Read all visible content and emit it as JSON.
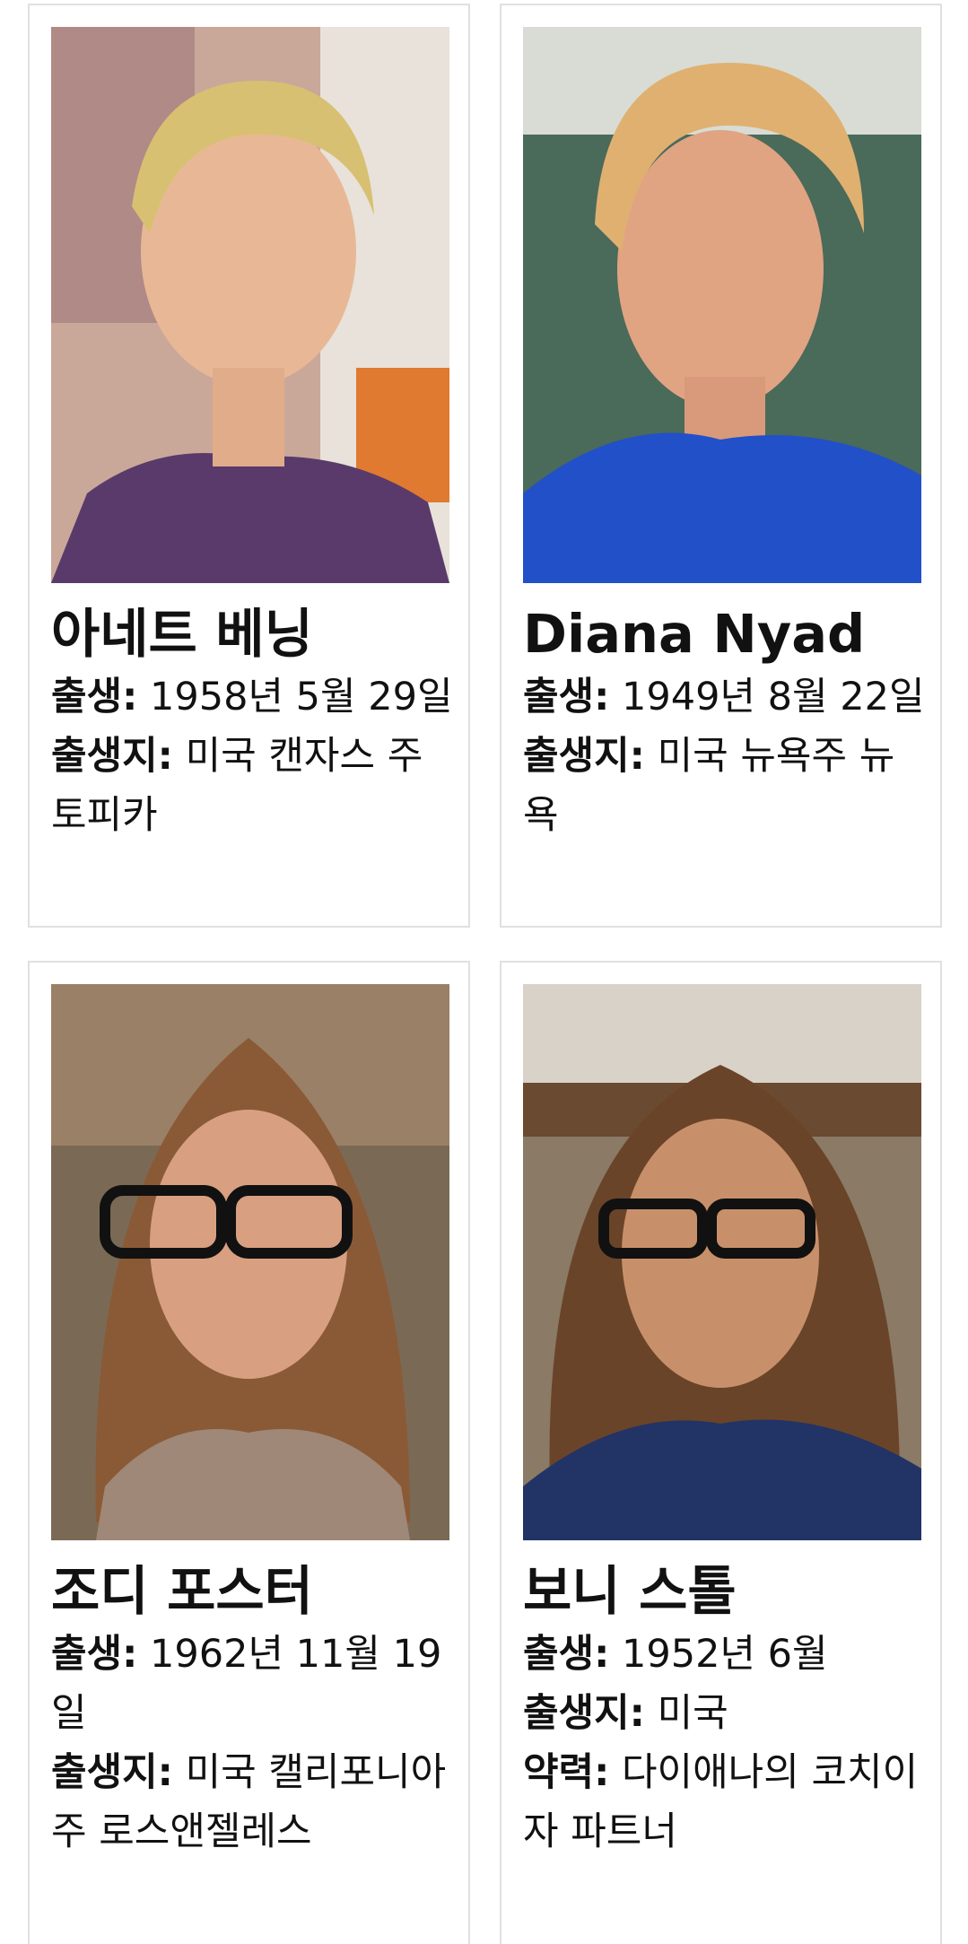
{
  "people": [
    {
      "name": "아네트 베닝",
      "fields": [
        {
          "label": "출생:",
          "value": "1958년 5월 29일"
        },
        {
          "label": "출생지:",
          "value": "미국 캔자스 주 토피카"
        }
      ]
    },
    {
      "name": "Diana Nyad",
      "fields": [
        {
          "label": "출생:",
          "value": "1949년 8월 22일"
        },
        {
          "label": "출생지:",
          "value": "미국 뉴욕주 뉴욕"
        }
      ]
    },
    {
      "name": "조디 포스터",
      "fields": [
        {
          "label": "출생:",
          "value": "1962년 11월 19일"
        },
        {
          "label": "출생지:",
          "value": "미국 캘리포니아 주 로스앤젤레스"
        }
      ]
    },
    {
      "name": "보니 스톨",
      "fields": [
        {
          "label": "출생:",
          "value": "1952년 6월"
        },
        {
          "label": "출생지:",
          "value": "미국"
        },
        {
          "label": "약력:",
          "value": "다이애나의 코치이자 파트너"
        }
      ]
    }
  ],
  "colors": {
    "card_border": "#e0e0e0",
    "text": "#111111",
    "photo1_bg": "#c9a89a",
    "photo2_bg": "#4a6a5a",
    "photo3_bg": "#7a6a55",
    "photo4_bg": "#8a7a66"
  }
}
